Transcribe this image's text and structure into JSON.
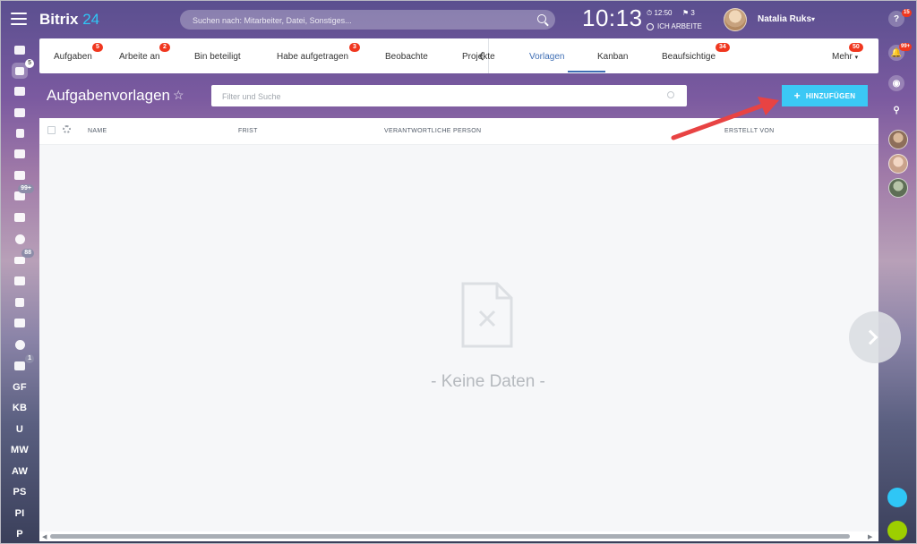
{
  "header": {
    "logo_text": "Bitrix",
    "logo_num": "24",
    "search_placeholder": "Suchen nach: Mitarbeiter, Datei, Sonstiges...",
    "clock": "10:13",
    "time_small": "12:50",
    "flag_count": "3",
    "work_status": "ICH ARBEITE",
    "user_name": "Natalia Ruks"
  },
  "left_sidebar": {
    "badges": {
      "tasks": "5",
      "mail": "99+",
      "filter": "88",
      "sync": "1"
    },
    "text_items": [
      "GF",
      "KB",
      "U",
      "MW",
      "AW",
      "PS",
      "PI",
      "P"
    ]
  },
  "right_sidebar": {
    "help_badge": "15",
    "notif_badge": "99+"
  },
  "tabs": [
    {
      "label": "Aufgaben",
      "badge": "5"
    },
    {
      "label": "Arbeite an",
      "badge": "2"
    },
    {
      "label": "Bin beteiligt",
      "badge": ""
    },
    {
      "label": "Habe aufgetragen",
      "badge": "3"
    },
    {
      "label": "Beobachte",
      "badge": ""
    },
    {
      "label": "Projekte",
      "badge": ""
    },
    {
      "label": "Vorlagen",
      "badge": ""
    },
    {
      "label": "Kanban",
      "badge": ""
    },
    {
      "label": "Beaufsichtige",
      "badge": "34"
    },
    {
      "label": "Mehr",
      "badge": "50"
    }
  ],
  "page": {
    "title": "Aufgabenvorlagen",
    "filter_placeholder": "Filter und Suche",
    "add_button": "HINZUFÜGEN"
  },
  "table": {
    "columns": [
      "NAME",
      "FRIST",
      "VERANTWORTLICHE PERSON",
      "ERSTELLT VON"
    ],
    "empty_text": "- Keine Daten -"
  },
  "colors": {
    "accent": "#3bc8f5",
    "active_tab": "#3f6eb4",
    "badge_red": "#f0371f",
    "arrow_red": "#e84343"
  }
}
